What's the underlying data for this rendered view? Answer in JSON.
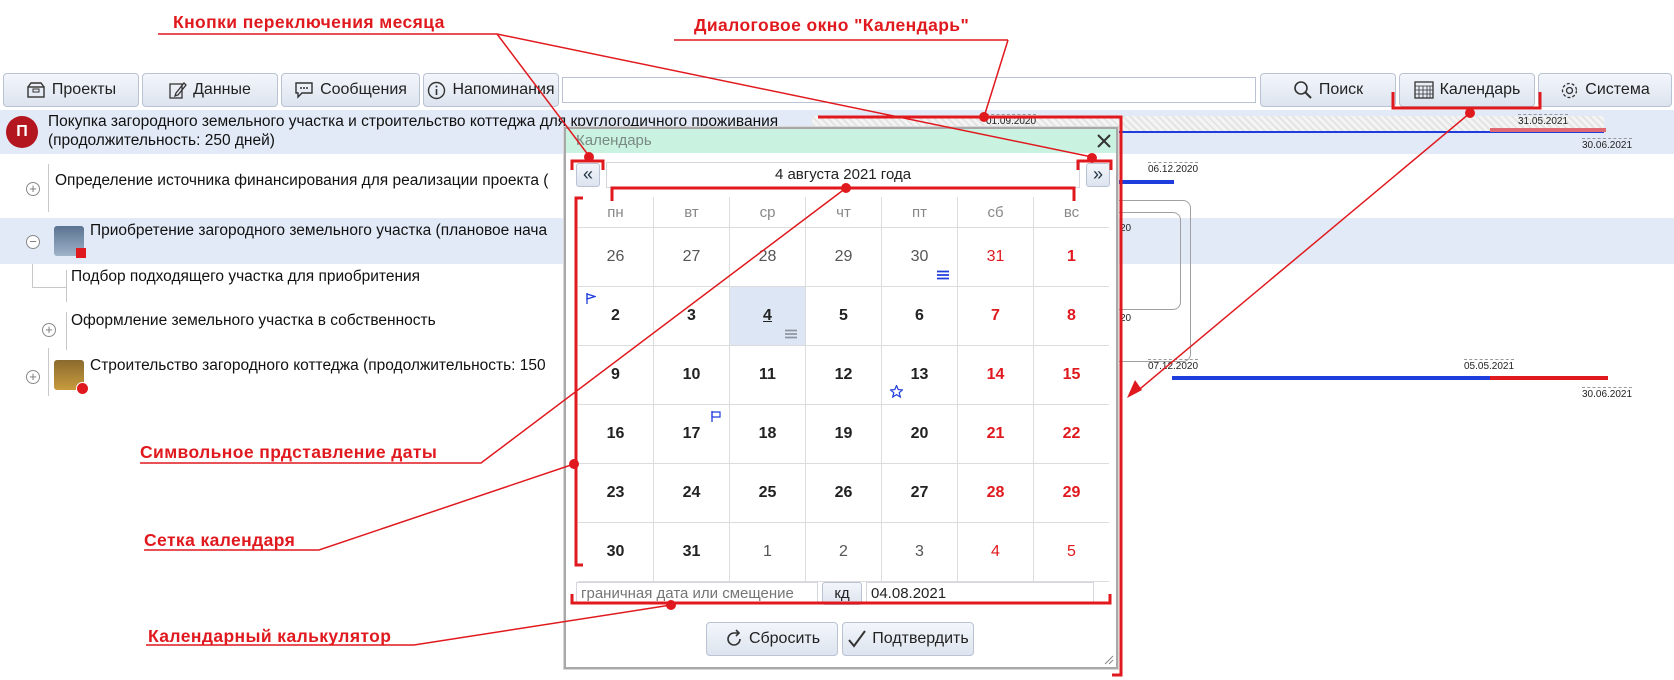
{
  "toolbar": {
    "projects": "Проекты",
    "data": "Данные",
    "messages": "Сообщения",
    "reminders": "Напоминания",
    "search": "Поиск",
    "calendar": "Календарь",
    "system": "Система",
    "search_value": ""
  },
  "project": {
    "badge": "П",
    "title_line1": "Покупка загородного земельного участка и строительство коттеджа для круглогодичного проживания",
    "title_line2": "(продолжительность: 250 дней)",
    "date_start": "01.09.2020",
    "date_mid": "31.05.2021",
    "date_end": "30.06.2021"
  },
  "tasks": [
    {
      "label": "Определение источника финансирования для реализации проекта (",
      "date": "06.12.2020"
    },
    {
      "label": "Приобретение загородного земельного участка (плановое нача",
      "date": "20"
    },
    {
      "label": "Подбор подходящего участка для приобритения"
    },
    {
      "label": "Оформление земельного участка в собственность",
      "date": "20"
    },
    {
      "label": "Строительство загородного коттеджа (продолжительность: 150",
      "date": "07.12.2020",
      "date_mid": "05.05.2021",
      "date_end": "30.06.2021"
    }
  ],
  "dialog": {
    "title": "Календарь",
    "date_text": "4 августа 2021 года",
    "prev_icon": "«",
    "next_icon": "»",
    "weekdays": [
      "пн",
      "вт",
      "ср",
      "чт",
      "пт",
      "сб",
      "вс"
    ],
    "weeks": [
      [
        "26",
        "27",
        "28",
        "29",
        "30",
        "31",
        "1"
      ],
      [
        "2",
        "3",
        "4",
        "5",
        "6",
        "7",
        "8"
      ],
      [
        "9",
        "10",
        "11",
        "12",
        "13",
        "14",
        "15"
      ],
      [
        "16",
        "17",
        "18",
        "19",
        "20",
        "21",
        "22"
      ],
      [
        "23",
        "24",
        "25",
        "26",
        "27",
        "28",
        "29"
      ],
      [
        "30",
        "31",
        "1",
        "2",
        "3",
        "4",
        "5"
      ]
    ],
    "calc_placeholder": "граничная дата или смещение",
    "calc_mode": "кд",
    "calc_result": "04.08.2021",
    "reset_label": "Сбросить",
    "confirm_label": "Подтвердить"
  },
  "annotations": {
    "month_buttons": "Кнопки переключения месяца",
    "dialog_window": "Диалоговое окно \"Календарь\"",
    "date_text": "Символьное прдставление даты",
    "grid": "Сетка календаря",
    "calculator": "Календарный калькулятор"
  },
  "colors": {
    "accent_red": "#e0191e",
    "gantt_blue": "#1f3ddc",
    "selected_bg": "#dde6f4",
    "dialog_title_bg": "#c9f2e0"
  }
}
